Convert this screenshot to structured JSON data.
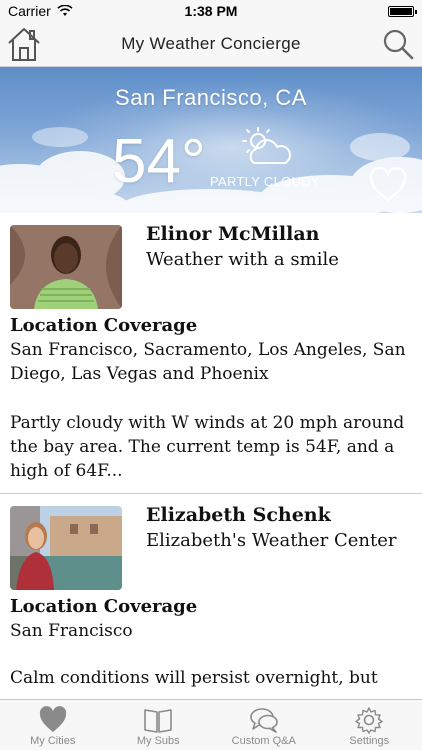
{
  "status_bar": {
    "carrier": "Carrier",
    "time": "1:38 PM"
  },
  "nav": {
    "title": "My Weather Concierge"
  },
  "hero": {
    "city": "San Francisco, CA",
    "temperature": "54°",
    "condition": "PARTLY CLOUDY",
    "condition_icon": "partly-cloudy-icon"
  },
  "cards": [
    {
      "name": "Elinor McMillan",
      "subtitle": "Weather with a smile",
      "coverage_label": "Location Coverage",
      "coverage": "San Francisco, Sacramento, Los Angeles, San Diego, Las Vegas and Phoenix",
      "forecast": "Partly cloudy with W winds at 20 mph around the bay area. The current temp is 54F, and a high of 64F..."
    },
    {
      "name": "Elizabeth Schenk",
      "subtitle": "Elizabeth's Weather Center",
      "coverage_label": "Location Coverage",
      "coverage": "San Francisco",
      "forecast": "Calm conditions will persist overnight, but"
    }
  ],
  "tabs": [
    {
      "label": "My Cities",
      "icon": "heart-icon"
    },
    {
      "label": "My Subs",
      "icon": "book-icon"
    },
    {
      "label": "Custom Q&A",
      "icon": "chat-bubbles-icon"
    },
    {
      "label": "Settings",
      "icon": "gear-icon"
    }
  ],
  "colors": {
    "sky_top": "#5e8ec9",
    "tab_inactive": "#8a8a8a",
    "divider": "#cfcfcf"
  }
}
